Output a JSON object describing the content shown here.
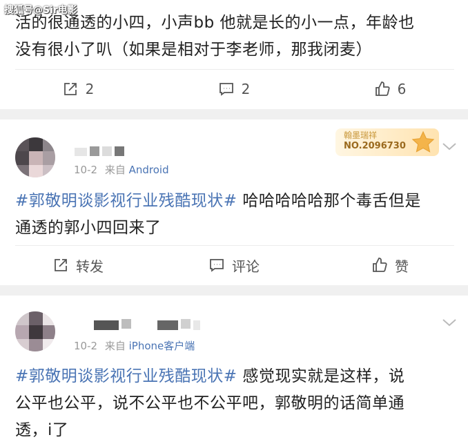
{
  "watermark": "搜狐号@Sir电影",
  "post1": {
    "text_line1": "活的很通透的小四，小声bb 他就是长的小一点，年龄也",
    "text_line2": "没有很小了叭（如果是相对于李老师，那我闭麦）",
    "repost_count": "2",
    "comment_count": "2",
    "like_count": "6"
  },
  "post2": {
    "date": "10-2",
    "source_prefix": "来自",
    "source": "Android",
    "badge_title": "翰墨瑞祥",
    "badge_number": "NO.2096730",
    "hashtag": "#郭敬明谈影视行业残酷现状#",
    "text_line1_rest": " 哈哈哈哈哈那个毒舌但是",
    "text_line2": "通透的郭小四回来了",
    "repost_label": "转发",
    "comment_label": "评论",
    "like_label": "赞"
  },
  "post3": {
    "date": "10-2",
    "source_prefix": "来自",
    "source": "iPhone客户端",
    "hashtag": "#郭敬明谈影视行业残酷现状#",
    "text_line1_rest": " 感觉现实就是这样，说",
    "text_line2": "公平也公平，说不公平也不公平吧，郭敬明的话简单通",
    "text_line3": "透，i了"
  }
}
